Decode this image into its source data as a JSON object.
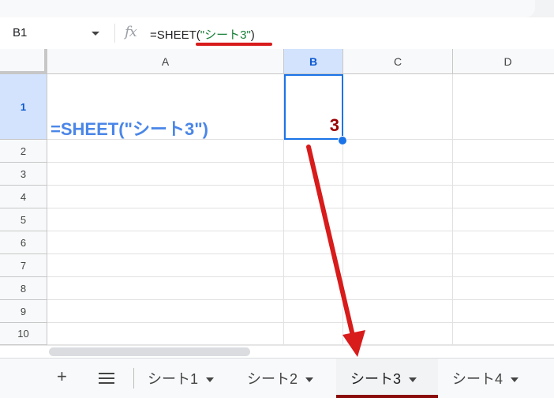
{
  "name_box": {
    "value": "B1"
  },
  "formula_bar": {
    "fx_label": "fx",
    "formula_prefix": "=SHEET",
    "paren_open": "(",
    "formula_arg": "\"シート3\"",
    "paren_close": ")"
  },
  "columns": [
    "A",
    "B",
    "C",
    "D"
  ],
  "rows": [
    "1",
    "2",
    "3",
    "4",
    "5",
    "6",
    "7",
    "8",
    "9",
    "10"
  ],
  "cells": {
    "A1": "=SHEET(\"シート3\")",
    "B1": "3"
  },
  "selected_cell": "B1",
  "sheet_bar": {
    "add_icon": "+",
    "tabs": [
      {
        "label": "シート1"
      },
      {
        "label": "シート2"
      },
      {
        "label": "シート3"
      },
      {
        "label": "シート4"
      }
    ],
    "active_tab": "シート3"
  },
  "colors": {
    "a1_text": "#4a86e8",
    "b1_text": "#990000",
    "annotation_red": "#d81b1b",
    "selection": "#1a73e8"
  }
}
